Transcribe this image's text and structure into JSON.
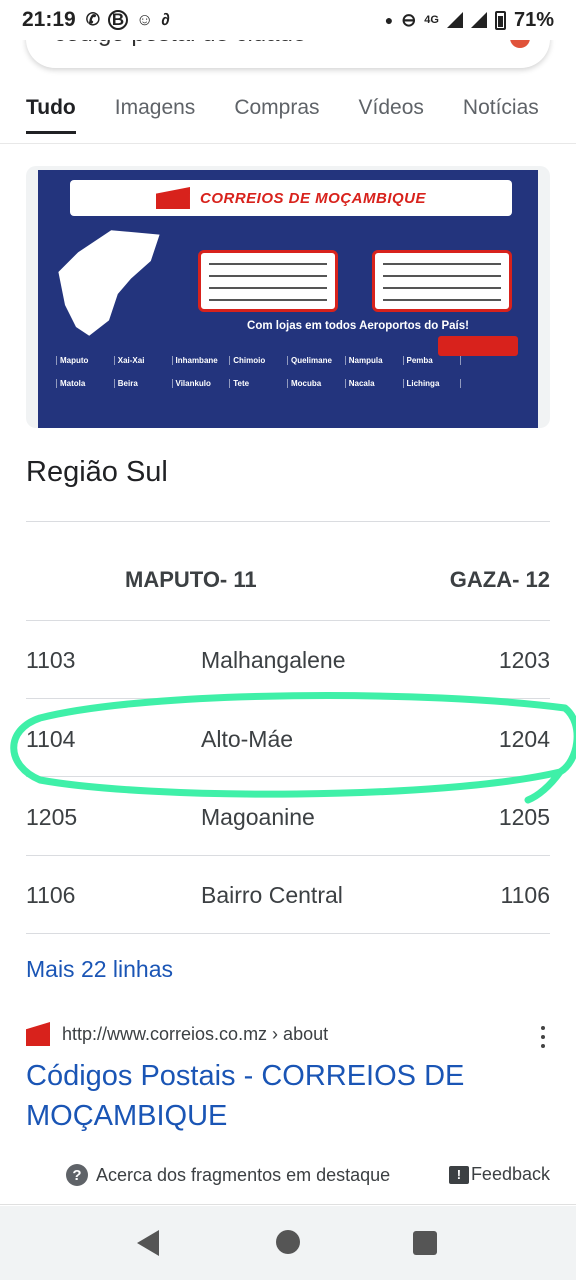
{
  "status_bar": {
    "time": "21:19",
    "network": "4G",
    "battery": "71%"
  },
  "search": {
    "query": "código postal de cidade"
  },
  "tabs": [
    {
      "label": "Tudo",
      "active": true
    },
    {
      "label": "Imagens"
    },
    {
      "label": "Compras"
    },
    {
      "label": "Vídeos"
    },
    {
      "label": "Notícias"
    }
  ],
  "image": {
    "banner_title": "CORREIOS DE MOÇAMBIQUE",
    "slogan": "Com lojas em todos Aeroportos do País!",
    "cities": [
      "Maputo",
      "Xai-Xai",
      "Inhambane",
      "Chimoio",
      "Quelimane",
      "Nampula",
      "Pemba",
      "",
      "Matola",
      "Beira",
      "Vilankulo",
      "Tete",
      "Mocuba",
      "Nacala",
      "Lichinga",
      ""
    ]
  },
  "region": {
    "title": "Região Sul",
    "col_headers": [
      "MAPUTO- 11",
      "GAZA- 12"
    ],
    "rows": [
      {
        "code_maputo": "1103",
        "name": "Malhangalene",
        "code_gaza": "1203"
      },
      {
        "code_maputo": "1104",
        "name": "Alto-Máe",
        "code_gaza": "1204"
      },
      {
        "code_maputo": "1205",
        "name": "Magoanine",
        "code_gaza": "1205"
      },
      {
        "code_maputo": "1106",
        "name": "Bairro Central",
        "code_gaza": "1106"
      }
    ],
    "more_link": "Mais 22 linhas"
  },
  "result": {
    "url": "http://www.correios.co.mz › about",
    "title": "Códigos Postais - CORREIOS DE MOÇAMBIQUE"
  },
  "footer": {
    "about": "Acerca dos fragmentos em destaque",
    "feedback": "Feedback"
  },
  "colors": {
    "link": "#1a55b5",
    "highlight": "#3ff0a8",
    "banner_bg": "#23347d",
    "brand_red": "#d8221c"
  }
}
